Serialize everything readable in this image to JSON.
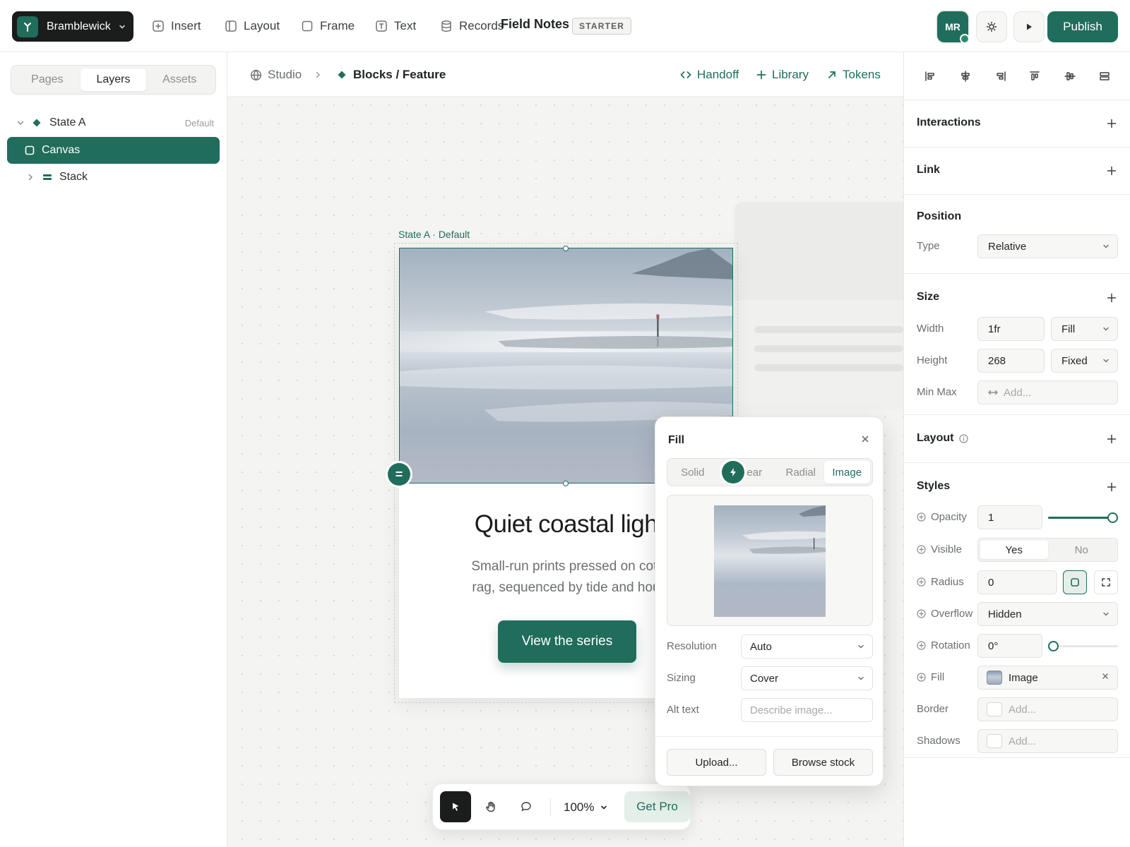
{
  "topbar": {
    "brand": "Bramblewick",
    "tools": [
      "Insert",
      "Layout",
      "Frame",
      "Text",
      "Records"
    ],
    "project_name": "Field Notes",
    "plan_badge": "STARTER",
    "avatar_initials": "MR",
    "publish_label": "Publish"
  },
  "left_panel": {
    "tabs": [
      "Pages",
      "Layers",
      "Assets"
    ],
    "active_tab": "Layers",
    "layers": [
      {
        "label": "State A",
        "meta": "Default",
        "expanded": true,
        "selected": false
      },
      {
        "label": "Canvas",
        "meta": "",
        "selected": true
      },
      {
        "label": "Stack",
        "meta": "",
        "expanded": false,
        "selected": false
      }
    ]
  },
  "breadcrumb": {
    "root": "Studio",
    "current": "Blocks / Feature",
    "actions": [
      "Handoff",
      "Library",
      "Tokens"
    ]
  },
  "canvas": {
    "frame_label": "State A · Default",
    "hero_title": "Quiet coastal ligh",
    "hero_sub_line1": "Small-run prints pressed on cott",
    "hero_sub_line2": "rag, sequenced by tide and hou",
    "cta_label": "View the series",
    "handle_glyph": "="
  },
  "bottom_toolbar": {
    "zoom": "100%",
    "pro_label": "Get Pro"
  },
  "fill_popover": {
    "title": "Fill",
    "tabs": [
      "Solid",
      "ear",
      "Radial",
      "Image"
    ],
    "active_tab": "Image",
    "resolution_label": "Resolution",
    "resolution_value": "Auto",
    "sizing_label": "Sizing",
    "sizing_value": "Cover",
    "alt_label": "Alt text",
    "alt_placeholder": "Describe image...",
    "upload_label": "Upload...",
    "stock_label": "Browse stock"
  },
  "right_panel": {
    "interactions_title": "Interactions",
    "link_title": "Link",
    "position": {
      "title": "Position",
      "type_label": "Type",
      "type_value": "Relative"
    },
    "size": {
      "title": "Size",
      "width_label": "Width",
      "width_value": "1fr",
      "width_mode": "Fill",
      "height_label": "Height",
      "height_value": "268",
      "height_mode": "Fixed",
      "minmax_label": "Min Max",
      "minmax_placeholder": "Add..."
    },
    "layout_title": "Layout",
    "styles": {
      "title": "Styles",
      "opacity_label": "Opacity",
      "opacity_value": "1",
      "opacity_level": 1.0,
      "visible_label": "Visible",
      "visible_yes": "Yes",
      "visible_no": "No",
      "radius_label": "Radius",
      "radius_value": "0",
      "overflow_label": "Overflow",
      "overflow_value": "Hidden",
      "rotation_label": "Rotation",
      "rotation_value": "0°",
      "rotation_level": 0.0,
      "fill_label": "Fill",
      "fill_value": "Image",
      "border_label": "Border",
      "border_placeholder": "Add...",
      "shadows_label": "Shadows",
      "shadows_placeholder": "Add..."
    }
  },
  "colors": {
    "accent": "#206d5c",
    "accent_soft": "#e4efe9",
    "dark": "#1a1d1b"
  }
}
